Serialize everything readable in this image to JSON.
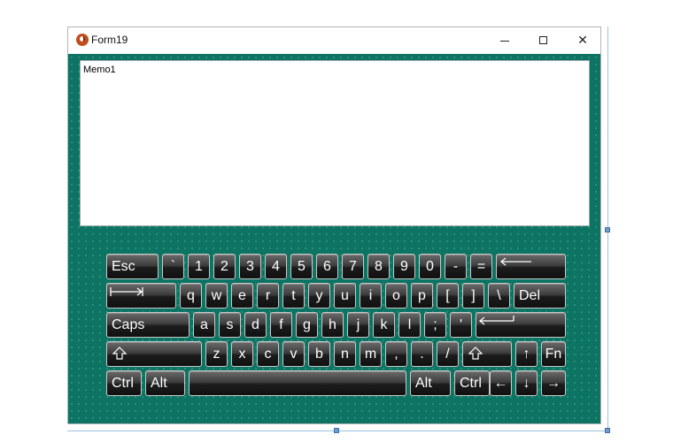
{
  "window": {
    "title": "Form19",
    "minimize_glyph": "",
    "close_glyph": "✕"
  },
  "memo": {
    "text": "Memo1"
  },
  "keyboard": {
    "row1": [
      "Esc",
      "`",
      "1",
      "2",
      "3",
      "4",
      "5",
      "6",
      "7",
      "8",
      "9",
      "0",
      "-",
      "="
    ],
    "row2": [
      "q",
      "w",
      "e",
      "r",
      "t",
      "y",
      "u",
      "i",
      "o",
      "p",
      "[",
      "]",
      "\\",
      "Del"
    ],
    "row3": [
      "Caps",
      "a",
      "s",
      "d",
      "f",
      "g",
      "h",
      "j",
      "k",
      "l",
      ";",
      "'"
    ],
    "row4": [
      "z",
      "x",
      "c",
      "v",
      "b",
      "n",
      "m",
      ",",
      ".",
      "/",
      "↑",
      "Fn"
    ],
    "row5": [
      "Ctrl",
      "Alt",
      "",
      "Alt",
      "Ctrl",
      "←",
      "↓",
      "→"
    ],
    "icons": {
      "backspace": "backspace-arrow-icon",
      "tab": "tab-arrow-icon",
      "enter": "enter-arrow-icon",
      "shift": "shift-arrow-icon"
    }
  },
  "colors": {
    "form_background": "#0d7464",
    "key_text": "#ffffff",
    "key_border": "#c9c9c9"
  }
}
